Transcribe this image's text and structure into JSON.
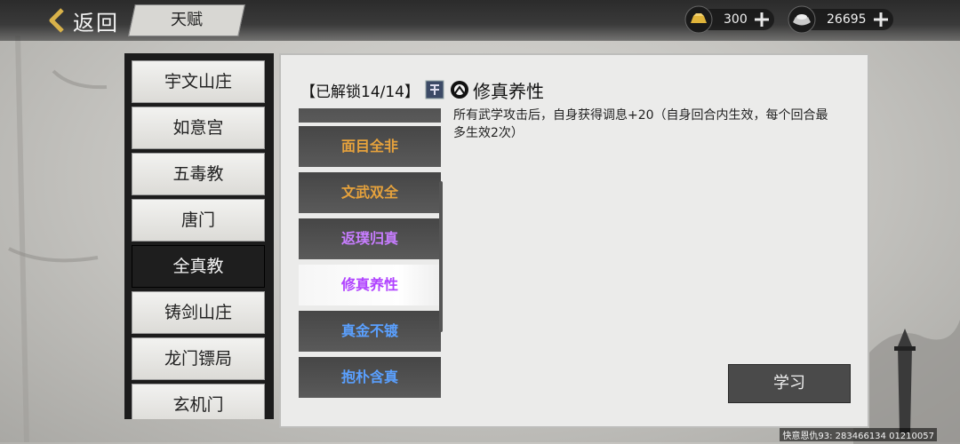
{
  "header": {
    "back_label": "返回",
    "title": "天赋"
  },
  "currency": {
    "gold": {
      "value": "300",
      "icon": "gold-ingot-icon"
    },
    "silver": {
      "value": "26695",
      "icon": "silver-ingot-icon"
    }
  },
  "sects": [
    {
      "label": "宇文山庄"
    },
    {
      "label": "如意宫"
    },
    {
      "label": "五毒教"
    },
    {
      "label": "唐门"
    },
    {
      "label": "全真教",
      "active": true
    },
    {
      "label": "铸剑山庄"
    },
    {
      "label": "龙门镖局"
    },
    {
      "label": "玄机门"
    }
  ],
  "panel": {
    "unlock_label": "【已解锁14/14】",
    "badge_icon": "rank-badge-icon",
    "school_icon": "yin-yang-icon",
    "talent_title": "修真养性",
    "description": "所有武学攻击后，自身获得调息+20（自身回合内生效，每个回合最多生效2次）",
    "learn_label": "学习"
  },
  "talents": [
    {
      "label": "面目全非",
      "color": "#e6a23c"
    },
    {
      "label": "文武双全",
      "color": "#e6a23c"
    },
    {
      "label": "返璞归真",
      "color": "#c77dff"
    },
    {
      "label": "修真养性",
      "color": "#b042ff",
      "active": true
    },
    {
      "label": "真金不镀",
      "color": "#5aa0ff"
    },
    {
      "label": "抱朴含真",
      "color": "#5aa0ff"
    }
  ],
  "footer": {
    "text": "快意恩仇93: 283466134  01210057"
  },
  "colors": {
    "gold_text": "#e6a23c",
    "purple_text": "#c77dff",
    "blue_text": "#5aa0ff"
  }
}
